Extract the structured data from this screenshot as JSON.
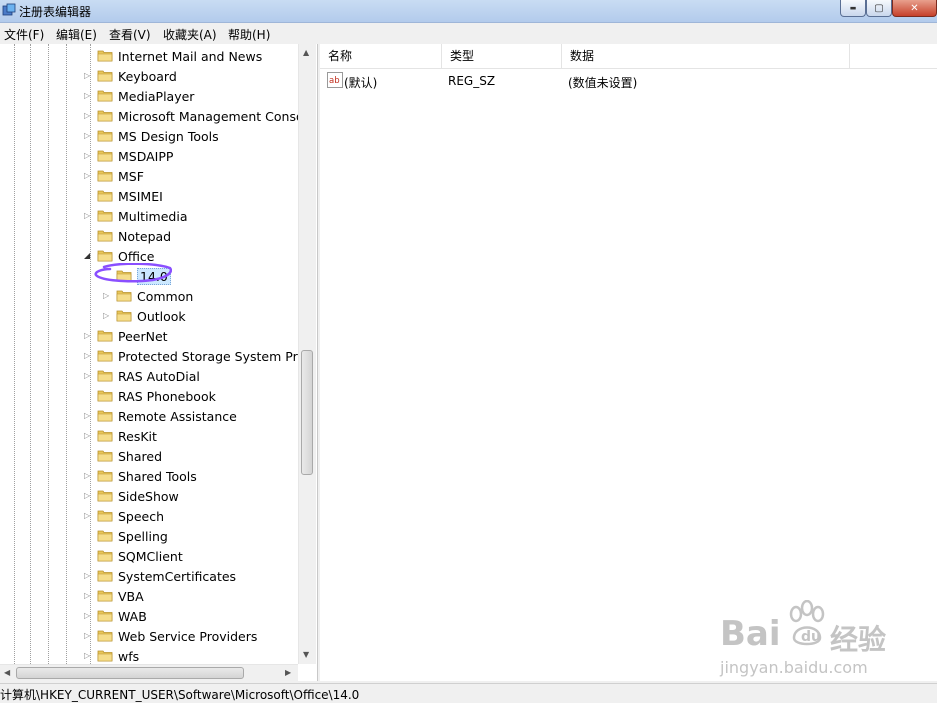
{
  "window": {
    "title": "注册表编辑器",
    "close_symbol": "✕",
    "min_symbol": "▬",
    "max_symbol": "▢"
  },
  "menu": [
    {
      "label": "文件(F)"
    },
    {
      "label": "编辑(E)"
    },
    {
      "label": "查看(V)"
    },
    {
      "label": "收藏夹(A)"
    },
    {
      "label": "帮助(H)"
    }
  ],
  "tree": {
    "items": [
      {
        "label": "Internet Mail and News",
        "level": 1,
        "expander": "none"
      },
      {
        "label": "Keyboard",
        "level": 1,
        "expander": "collapsed"
      },
      {
        "label": "MediaPlayer",
        "level": 1,
        "expander": "collapsed"
      },
      {
        "label": "Microsoft Management Conso",
        "level": 1,
        "expander": "collapsed"
      },
      {
        "label": "MS Design Tools",
        "level": 1,
        "expander": "collapsed"
      },
      {
        "label": "MSDAIPP",
        "level": 1,
        "expander": "collapsed"
      },
      {
        "label": "MSF",
        "level": 1,
        "expander": "collapsed"
      },
      {
        "label": "MSIMEI",
        "level": 1,
        "expander": "none"
      },
      {
        "label": "Multimedia",
        "level": 1,
        "expander": "collapsed"
      },
      {
        "label": "Notepad",
        "level": 1,
        "expander": "none"
      },
      {
        "label": "Office",
        "level": 1,
        "expander": "expanded"
      },
      {
        "label": "14.0",
        "level": 2,
        "expander": "none",
        "selected": true
      },
      {
        "label": "Common",
        "level": 2,
        "expander": "collapsed"
      },
      {
        "label": "Outlook",
        "level": 2,
        "expander": "collapsed"
      },
      {
        "label": "PeerNet",
        "level": 1,
        "expander": "collapsed"
      },
      {
        "label": "Protected Storage System Prov",
        "level": 1,
        "expander": "collapsed"
      },
      {
        "label": "RAS AutoDial",
        "level": 1,
        "expander": "collapsed"
      },
      {
        "label": "RAS Phonebook",
        "level": 1,
        "expander": "none"
      },
      {
        "label": "Remote Assistance",
        "level": 1,
        "expander": "collapsed"
      },
      {
        "label": "ResKit",
        "level": 1,
        "expander": "collapsed"
      },
      {
        "label": "Shared",
        "level": 1,
        "expander": "none"
      },
      {
        "label": "Shared Tools",
        "level": 1,
        "expander": "collapsed"
      },
      {
        "label": "SideShow",
        "level": 1,
        "expander": "collapsed"
      },
      {
        "label": "Speech",
        "level": 1,
        "expander": "collapsed"
      },
      {
        "label": "Spelling",
        "level": 1,
        "expander": "none"
      },
      {
        "label": "SQMClient",
        "level": 1,
        "expander": "none"
      },
      {
        "label": "SystemCertificates",
        "level": 1,
        "expander": "collapsed"
      },
      {
        "label": "VBA",
        "level": 1,
        "expander": "collapsed"
      },
      {
        "label": "WAB",
        "level": 1,
        "expander": "collapsed"
      },
      {
        "label": "Web Service Providers",
        "level": 1,
        "expander": "collapsed"
      },
      {
        "label": "wfs",
        "level": 1,
        "expander": "collapsed"
      }
    ]
  },
  "list": {
    "columns": [
      "名称",
      "类型",
      "数据"
    ],
    "rows": [
      {
        "name": "(默认)",
        "type": "REG_SZ",
        "data": "(数值未设置)"
      }
    ]
  },
  "status": {
    "path": "计算机\\HKEY_CURRENT_USER\\Software\\Microsoft\\Office\\14.0"
  },
  "watermark": {
    "brand_text": "Bai",
    "brand_suffix": "经验",
    "url": "jingyan.baidu.com"
  },
  "colors": {
    "folder": "#e8c65a",
    "highlight_ring": "#8a4fff",
    "selection": "#cce8ff"
  }
}
